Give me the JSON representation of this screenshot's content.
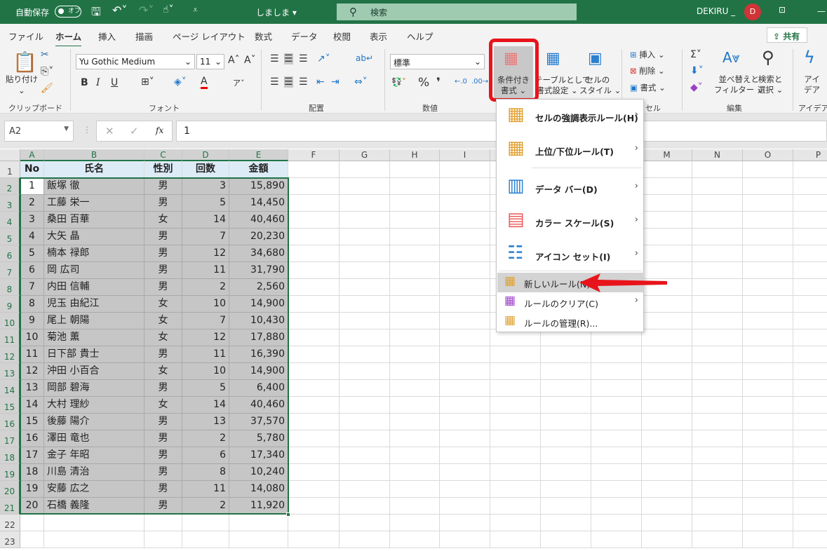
{
  "titlebar": {
    "autosave": "自動保存",
    "autosave_state": "オフ",
    "filename": "しましま",
    "search": "検索",
    "user": "DEKIRU _",
    "avatar": "D"
  },
  "tabs": [
    "ファイル",
    "ホーム",
    "挿入",
    "描画",
    "ページ レイアウト",
    "数式",
    "データ",
    "校閲",
    "表示",
    "ヘルプ"
  ],
  "active_tab": "ホーム",
  "share": "共有",
  "ribbon": {
    "clipboard": {
      "paste": "貼り付け",
      "label": "クリップボード"
    },
    "font": {
      "name": "Yu Gothic Medium",
      "size": "11",
      "bold": "B",
      "italic": "I",
      "underline": "U",
      "label": "フォント"
    },
    "alignment": {
      "label": "配置"
    },
    "number": {
      "format": "標準",
      "percent": "%",
      "comma": "❜",
      "label": "数値"
    },
    "styles": {
      "conditional": [
        "条件付き",
        "書式 ⌄"
      ],
      "table": [
        "テーブルとして",
        "書式設定 ⌄"
      ],
      "cellstyle": [
        "セルの",
        "スタイル ⌄"
      ]
    },
    "cells": {
      "insert": "挿入",
      "delete": "削除",
      "format": "書式",
      "label": "セル"
    },
    "editing": {
      "sort": [
        "並べ替えと",
        "フィルター ⌄"
      ],
      "find": [
        "検索と",
        "選択 ⌄"
      ],
      "label": "編集"
    },
    "ideas": {
      "btn": [
        "アイ",
        "デア"
      ],
      "label": "アイデア"
    }
  },
  "formula_bar": {
    "namebox": "A2",
    "fx": "fx",
    "value": "1"
  },
  "columns": [
    "A",
    "B",
    "C",
    "D",
    "E",
    "F",
    "G",
    "H",
    "I",
    "J",
    "K",
    "L",
    "M",
    "N",
    "O",
    "P"
  ],
  "rows": [
    "1",
    "2",
    "3",
    "4",
    "5",
    "6",
    "7",
    "8",
    "9",
    "10",
    "11",
    "12",
    "13",
    "14",
    "15",
    "16",
    "17",
    "18",
    "19",
    "20",
    "21",
    "22",
    "23"
  ],
  "table": {
    "headers": [
      "No",
      "氏名",
      "性別",
      "回数",
      "金額"
    ],
    "data": [
      [
        "1",
        "飯塚 徹",
        "男",
        "3",
        "15,890"
      ],
      [
        "2",
        "工藤 栄一",
        "男",
        "5",
        "14,450"
      ],
      [
        "3",
        "桑田 百華",
        "女",
        "14",
        "40,460"
      ],
      [
        "4",
        "大矢 晶",
        "男",
        "7",
        "20,230"
      ],
      [
        "5",
        "楠本 禄郎",
        "男",
        "12",
        "34,680"
      ],
      [
        "6",
        "岡 広司",
        "男",
        "11",
        "31,790"
      ],
      [
        "7",
        "内田 信輔",
        "男",
        "2",
        "2,560"
      ],
      [
        "8",
        "児玉 由紀江",
        "女",
        "10",
        "14,900"
      ],
      [
        "9",
        "尾上 朝陽",
        "女",
        "7",
        "10,430"
      ],
      [
        "10",
        "菊池 薫",
        "女",
        "12",
        "17,880"
      ],
      [
        "11",
        "日下部 貴士",
        "男",
        "11",
        "16,390"
      ],
      [
        "12",
        "沖田 小百合",
        "女",
        "10",
        "14,900"
      ],
      [
        "13",
        "岡部 碧海",
        "男",
        "5",
        "6,400"
      ],
      [
        "14",
        "大村 理紗",
        "女",
        "14",
        "40,460"
      ],
      [
        "15",
        "後藤 陽介",
        "男",
        "13",
        "37,570"
      ],
      [
        "16",
        "澤田 竜也",
        "男",
        "2",
        "5,780"
      ],
      [
        "17",
        "金子 年昭",
        "男",
        "6",
        "17,340"
      ],
      [
        "18",
        "川島 清治",
        "男",
        "8",
        "10,240"
      ],
      [
        "19",
        "安藤 広之",
        "男",
        "11",
        "14,080"
      ],
      [
        "20",
        "石橋 義隆",
        "男",
        "2",
        "11,920"
      ]
    ]
  },
  "menu": {
    "items": [
      {
        "label": "セルの強調表示ルール(H)",
        "icon": "highlight-rules-icon",
        "submenu": true
      },
      {
        "label": "上位/下位ルール(T)",
        "icon": "top-bottom-icon",
        "submenu": true
      },
      {
        "label": "データ バー(D)",
        "icon": "data-bar-icon",
        "submenu": true
      },
      {
        "label": "カラー スケール(S)",
        "icon": "color-scale-icon",
        "submenu": true
      },
      {
        "label": "アイコン セット(I)",
        "icon": "icon-set-icon",
        "submenu": true
      },
      {
        "label": "新しいルール(N)...",
        "icon": "new-rule-icon",
        "submenu": false,
        "highlighted": true
      },
      {
        "label": "ルールのクリア(C)",
        "icon": "clear-rules-icon",
        "submenu": true
      },
      {
        "label": "ルールの管理(R)...",
        "icon": "manage-rules-icon",
        "submenu": false
      }
    ]
  },
  "colors": {
    "excel_green": "#217346",
    "header_fill": "#ddebf7",
    "selection_fill": "#c6c6c6",
    "annotation_red": "#e8141b"
  }
}
